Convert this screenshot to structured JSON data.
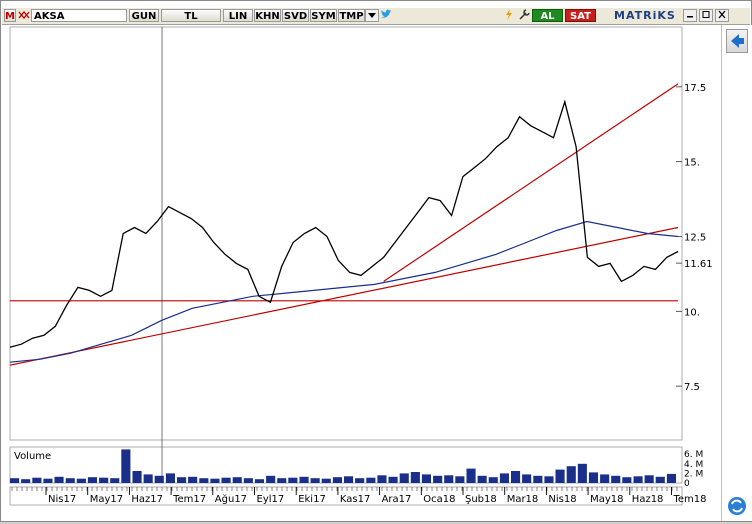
{
  "toolbar": {
    "m_label": "M",
    "symbol": "AKSA",
    "period": "GUN",
    "currency": "TL",
    "scale": "LIN",
    "khn": "KHN",
    "svd": "SVD",
    "sym": "SYM",
    "tmp": "TMP",
    "buy": "AL",
    "sell": "SAT",
    "brand": "MATRiKS"
  },
  "chart_data": {
    "type": "line",
    "price_axis": {
      "ticks": [
        "17.5",
        "15.",
        "12.5",
        "11.61",
        "10.",
        "7.5"
      ],
      "tick_values": [
        17.5,
        15,
        12.5,
        11.61,
        10,
        7.5
      ],
      "current_value": 11.61,
      "ylim": [
        5.7,
        19.5
      ]
    },
    "x_axis": {
      "labels": [
        "Nis17",
        "May17",
        "Haz17",
        "Tem17",
        "Ağu17",
        "Eyl17",
        "Eki17",
        "Kas17",
        "Ara17",
        "Oca18",
        "Şub18",
        "Mar18",
        "Nis18",
        "May18",
        "Haz18",
        "Tem18"
      ]
    },
    "price_series": {
      "name": "AKSA",
      "color": "#000000",
      "values": [
        8.8,
        8.9,
        9.1,
        9.2,
        9.5,
        10.2,
        10.8,
        10.7,
        10.5,
        10.7,
        12.6,
        12.8,
        12.6,
        13.0,
        13.5,
        13.3,
        13.1,
        12.8,
        12.3,
        11.9,
        11.6,
        11.4,
        10.5,
        10.3,
        11.5,
        12.3,
        12.6,
        12.8,
        12.5,
        11.7,
        11.3,
        11.2,
        11.5,
        11.8,
        12.3,
        12.8,
        13.3,
        13.8,
        13.7,
        13.2,
        14.5,
        14.8,
        15.1,
        15.5,
        15.8,
        16.5,
        16.2,
        16.0,
        15.8,
        17.0,
        15.5,
        11.8,
        11.5,
        11.6,
        11.0,
        11.2,
        11.5,
        11.4,
        11.8,
        12.0
      ]
    },
    "moving_average": {
      "color": "#1a2f8a",
      "values": [
        8.3,
        8.4,
        8.6,
        8.9,
        9.2,
        9.7,
        10.1,
        10.3,
        10.5,
        10.6,
        10.7,
        10.8,
        10.9,
        11.1,
        11.3,
        11.6,
        11.9,
        12.3,
        12.7,
        13.0,
        12.8,
        12.6,
        12.5
      ]
    },
    "trend_lines": [
      {
        "color": "#c00000",
        "from": [
          0,
          8.2
        ],
        "to": [
          59,
          12.8
        ]
      },
      {
        "color": "#c00000",
        "from": [
          33,
          11.0
        ],
        "to": [
          59,
          17.6
        ]
      },
      {
        "color": "#c00000",
        "from": [
          0,
          10.35
        ],
        "to": [
          59,
          10.35
        ]
      }
    ],
    "volume": {
      "title": "Volume",
      "ticks": [
        "6. M",
        "4. M",
        "2. M",
        "0"
      ],
      "tick_values": [
        6,
        4,
        2,
        0
      ],
      "color": "#1a2f8a",
      "values": [
        1.0,
        0.8,
        1.1,
        0.9,
        1.3,
        1.0,
        0.9,
        1.2,
        1.1,
        1.0,
        7.0,
        2.5,
        1.8,
        1.5,
        2.0,
        1.2,
        1.3,
        1.0,
        0.9,
        1.1,
        1.2,
        1.0,
        0.8,
        1.5,
        1.0,
        1.1,
        1.3,
        1.0,
        0.9,
        1.2,
        1.4,
        1.0,
        1.1,
        1.6,
        1.3,
        2.0,
        2.3,
        1.8,
        1.5,
        1.6,
        1.4,
        3.0,
        1.5,
        1.2,
        2.0,
        2.5,
        1.8,
        1.5,
        1.4,
        2.8,
        3.5,
        4.0,
        2.2,
        1.8,
        1.5,
        1.2,
        1.4,
        1.6,
        1.3,
        1.9
      ],
      "ylim": [
        0,
        7.5
      ]
    }
  }
}
